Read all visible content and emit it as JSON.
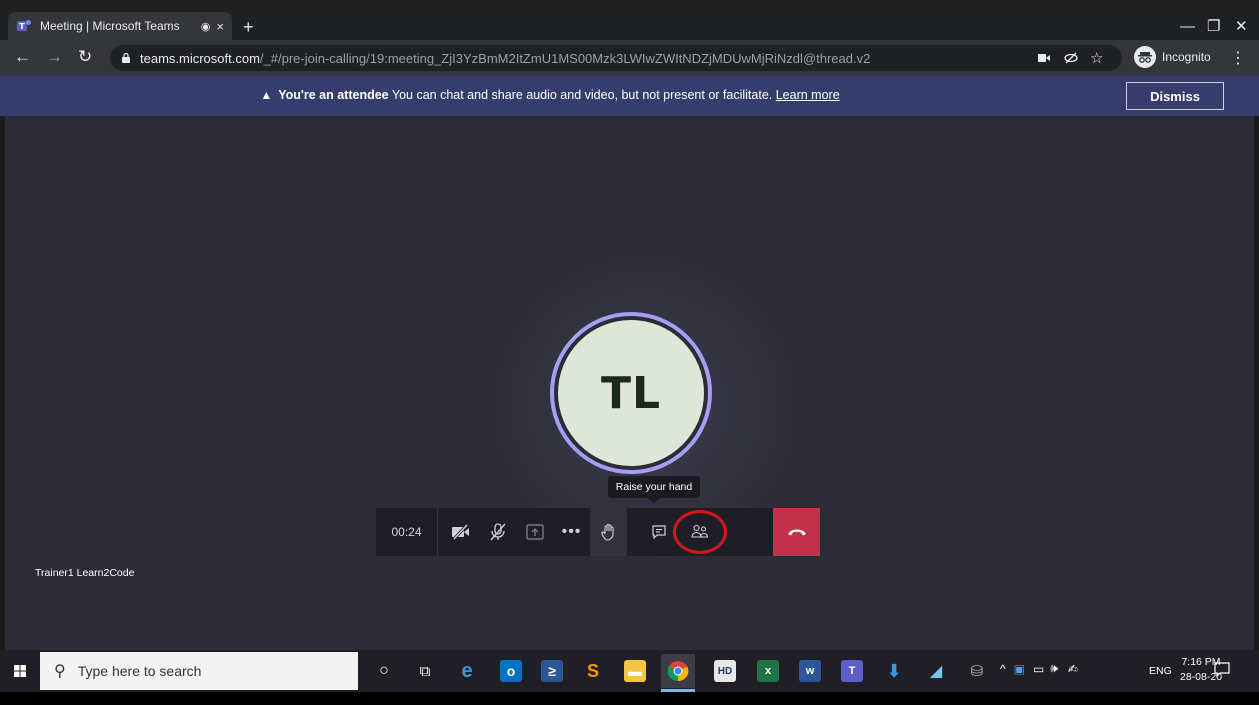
{
  "browser": {
    "tab_title": "Meeting | Microsoft Teams",
    "tab_recording_dot": "◉",
    "tab_close": "×",
    "new_tab": "+",
    "url_host": "teams.microsoft.com",
    "url_path": "/_#/pre-join-calling/19:meeting_ZjI3YzBmM2ItZmU1MS00Mzk3LWIwZWItNDZjMDUwMjRiNzdl@thread.v2",
    "incognito_label": "Incognito",
    "accent_color": "#202124"
  },
  "banner": {
    "bold_text": "You're an attendee",
    "text": " You can chat and share audio and video, but not present or facilitate. ",
    "link_text": "Learn more",
    "dismiss_label": "Dismiss",
    "background": "#363c6c"
  },
  "meeting": {
    "avatar_initials": "TL",
    "avatar_ring_color": "#a49ef5",
    "tooltip": "Raise your hand",
    "timer": "00:24",
    "participant_name": "Trainer1 Learn2Code",
    "hangup_color": "#c4314b",
    "controls": [
      "camera-off",
      "mic-off",
      "share",
      "more",
      "raise-hand",
      "chat",
      "participants",
      "hang-up"
    ]
  },
  "taskbar": {
    "search_placeholder": "Type here to search",
    "language": "ENG",
    "time": "7:16 PM",
    "date": "28-08-20"
  }
}
